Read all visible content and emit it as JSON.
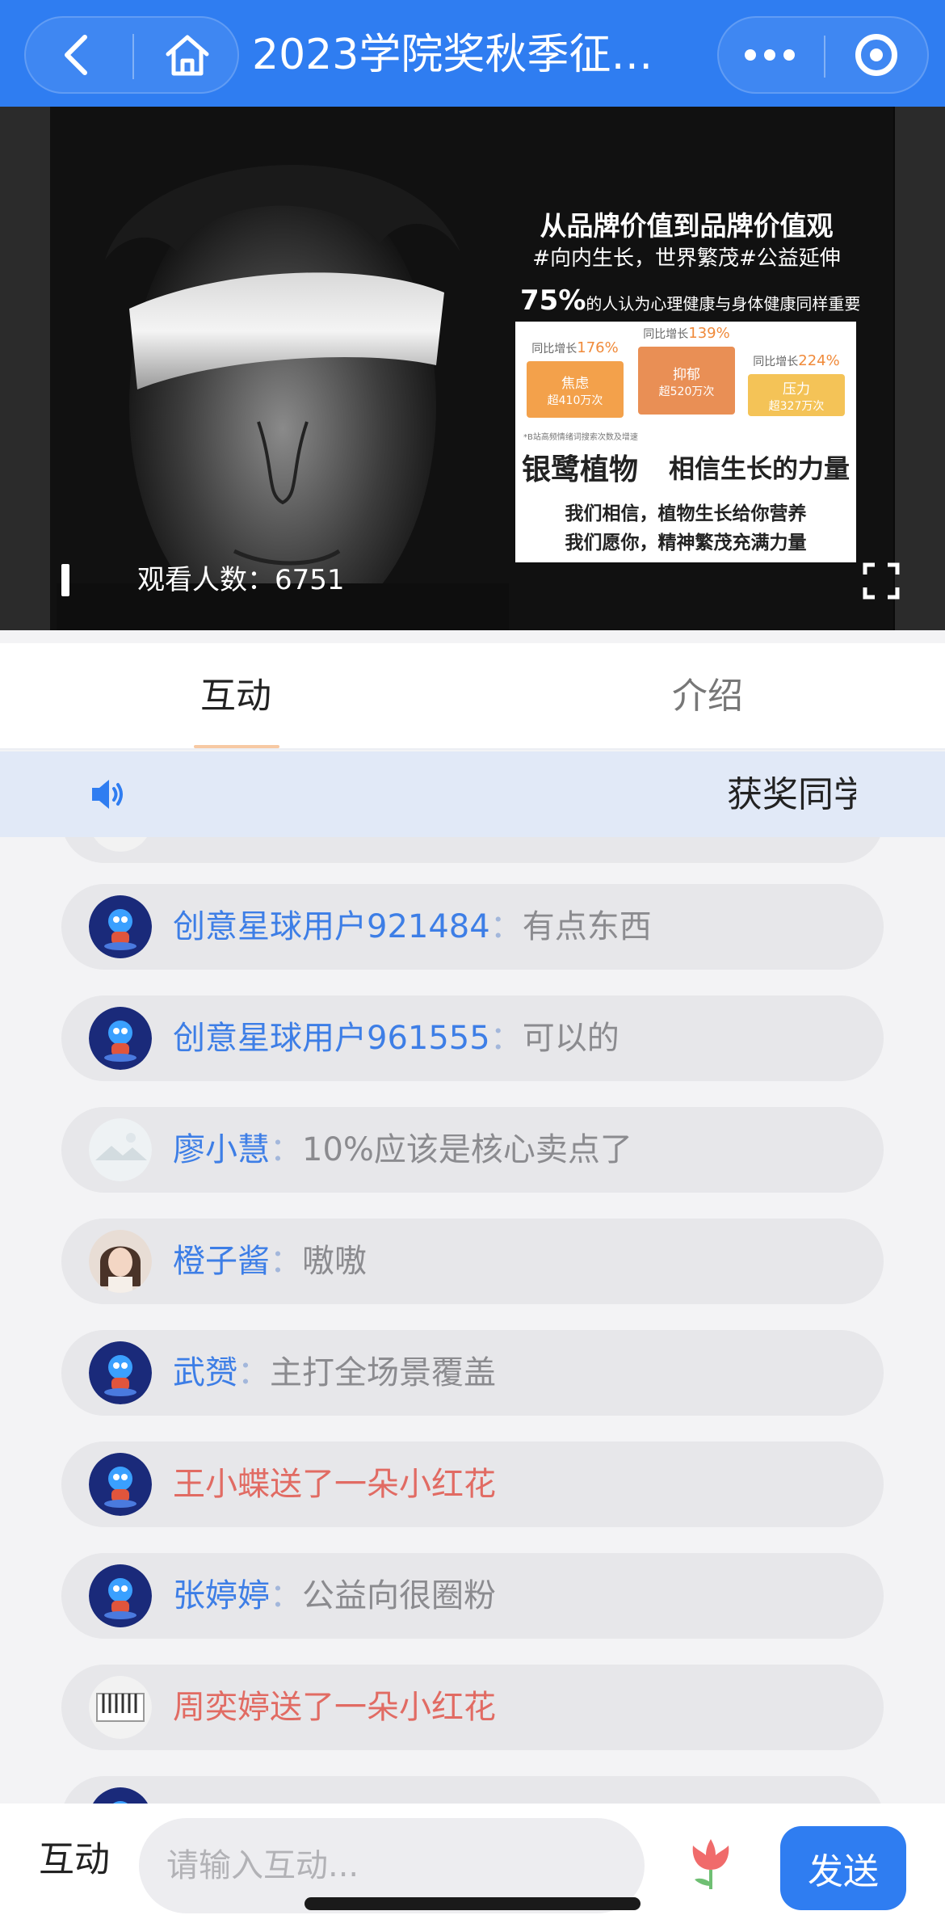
{
  "header": {
    "title": "2023学院奖秋季征…",
    "back_icon": "chevron-left-icon",
    "home_icon": "home-icon",
    "more_icon": "more-dots-icon",
    "record_icon": "record-icon"
  },
  "video": {
    "overlay": {
      "title": "从品牌价值到品牌价值观",
      "subtitle": "#向内生长，世界繁茂#公益延伸",
      "stat_percent": "75%",
      "stat_text": "的人认为心理健康与身体健康同样重要",
      "stats": [
        {
          "growth_label": "同比增长",
          "growth_value": "176%",
          "name": "焦虑",
          "count": "超410万次",
          "color": "#f3a14b"
        },
        {
          "growth_label": "同比增长",
          "growth_value": "139%",
          "name": "抑郁",
          "count": "超520万次",
          "color": "#e98f55"
        },
        {
          "growth_label": "同比增长",
          "growth_value": "224%",
          "name": "压力",
          "count": "超327万次",
          "color": "#f4c357"
        }
      ],
      "footnote": "*B站高频情绪词搜索次数及增速",
      "brand_name": "银鹭植物",
      "brand_slogan": "相信生长的力量",
      "line1": "我们相信，植物生长给你营养",
      "line2": "我们愿你，精神繁茂充满力量"
    },
    "viewers_label": "观看人数：6751",
    "pause_icon": "pause-icon",
    "fullscreen_icon": "fullscreen-icon"
  },
  "tabs": [
    {
      "label": "互动",
      "active": true
    },
    {
      "label": "介绍",
      "active": false
    }
  ],
  "notice": {
    "icon": "speaker-icon",
    "text": "获奖同学"
  },
  "chat": [
    {
      "nick": "创意星球用户921484",
      "colon": "：",
      "text": "有点东西",
      "type": "comment",
      "avatar": "mascot",
      "accent": "#3d7ee6"
    },
    {
      "nick": "创意星球用户961555",
      "colon": "：",
      "text": "可以的",
      "type": "comment",
      "avatar": "mascot",
      "accent": "#3d7ee6"
    },
    {
      "nick": "廖小慧",
      "colon": "：",
      "text": "10%应该是核心卖点了",
      "type": "comment",
      "avatar": "landscape",
      "accent": "#3d7ee6"
    },
    {
      "nick": "橙子酱",
      "colon": "：",
      "text": "嗷嗷",
      "type": "comment",
      "avatar": "portrait",
      "accent": "#3d7ee6"
    },
    {
      "nick": "武赟",
      "colon": "：",
      "text": "主打全场景覆盖",
      "type": "comment",
      "avatar": "mascot",
      "accent": "#3d7ee6"
    },
    {
      "nick": "",
      "colon": "",
      "text": "王小蝶送了一朵小红花",
      "type": "gift",
      "avatar": "mascot",
      "accent": "#e16b63"
    },
    {
      "nick": "张婷婷",
      "colon": "：",
      "text": "公益向很圈粉",
      "type": "comment",
      "avatar": "mascot",
      "accent": "#3d7ee6"
    },
    {
      "nick": "",
      "colon": "",
      "text": "周奕婷送了一朵小红花",
      "type": "gift",
      "avatar": "keys",
      "accent": "#e16b63"
    }
  ],
  "bottom": {
    "label": "互动",
    "input_placeholder": "请输入互动...",
    "flower_icon": "tulip-icon",
    "send_label": "发送"
  }
}
